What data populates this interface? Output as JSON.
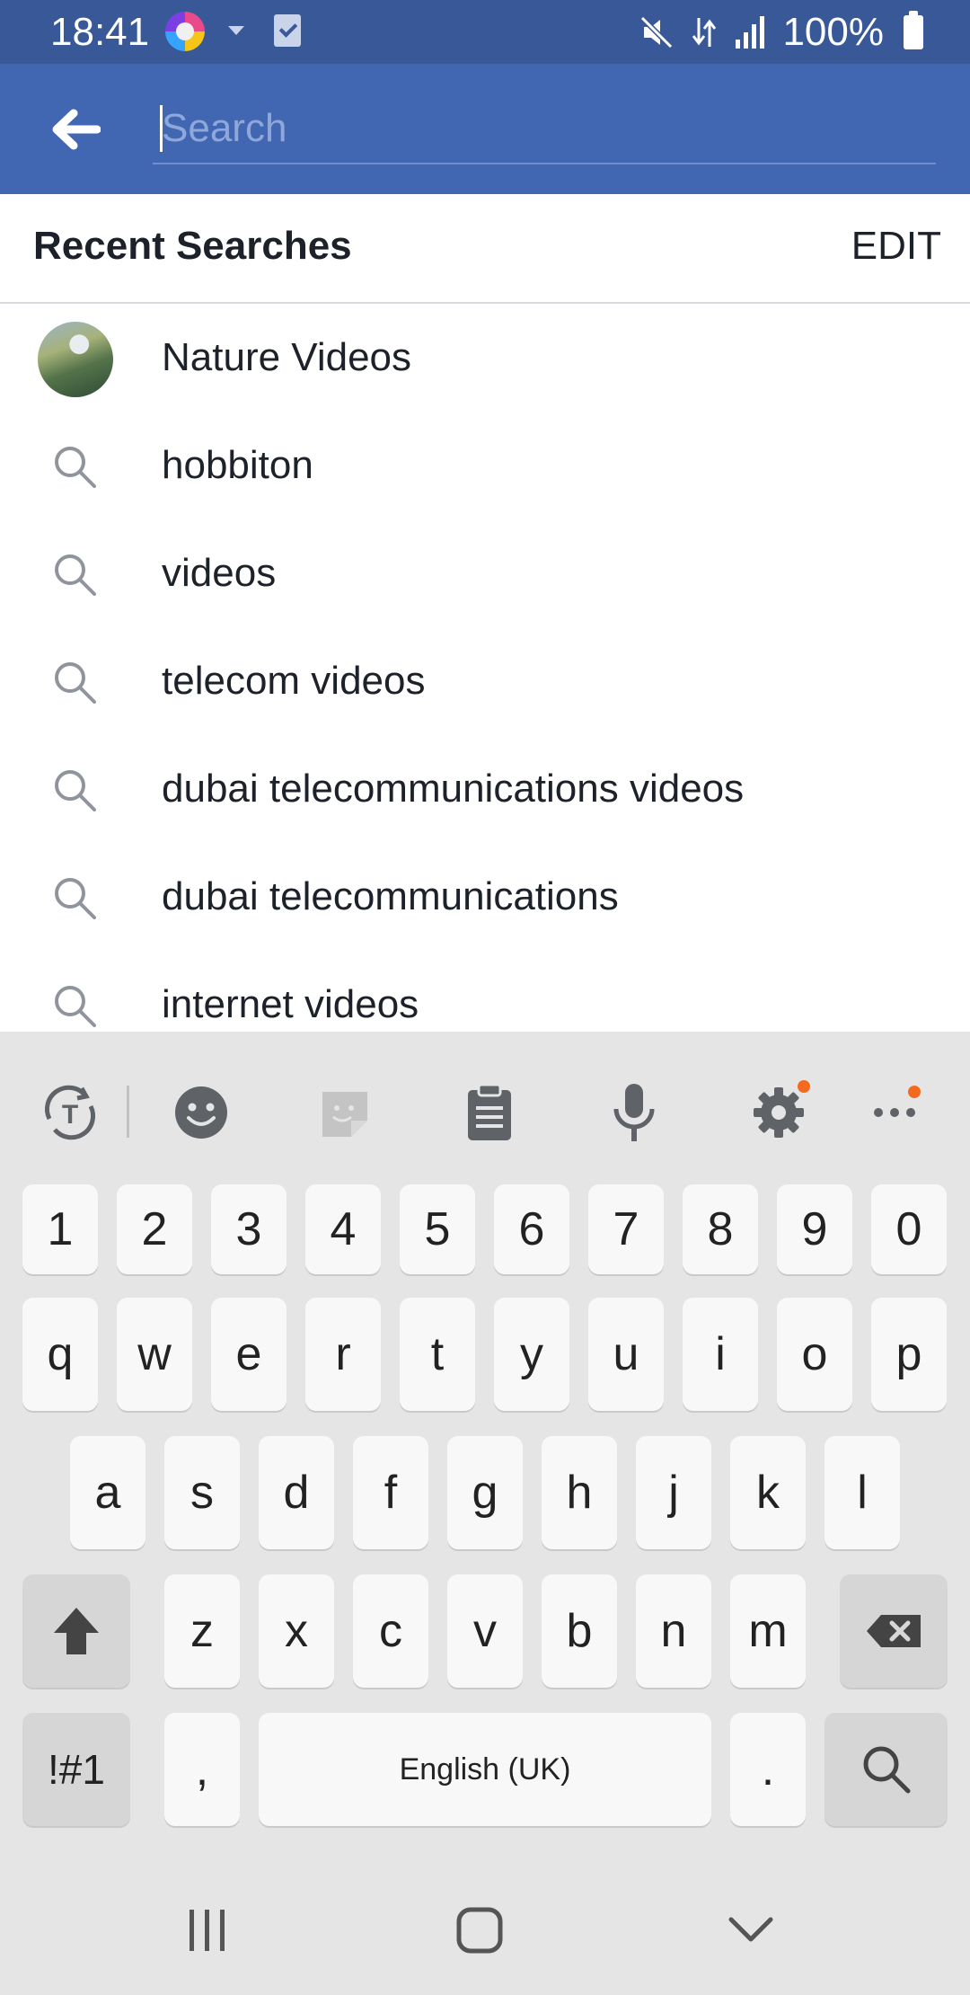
{
  "status_bar": {
    "time": "18:41",
    "battery_percent": "100%",
    "icons": [
      "browser-app-icon",
      "dropdown-caret-icon",
      "checkbox-notification-icon",
      "mute-icon",
      "data-transfer-icon",
      "signal-icon",
      "battery-icon"
    ]
  },
  "search": {
    "placeholder": "Search",
    "value": "",
    "back_icon": "arrow-left-icon"
  },
  "recent": {
    "title": "Recent Searches",
    "edit_label": "EDIT",
    "items": [
      {
        "label": "Nature Videos",
        "icon": "page-thumbnail"
      },
      {
        "label": "hobbiton",
        "icon": "search-icon"
      },
      {
        "label": "videos",
        "icon": "search-icon"
      },
      {
        "label": "telecom videos",
        "icon": "search-icon"
      },
      {
        "label": "dubai telecommunications videos",
        "icon": "search-icon"
      },
      {
        "label": "dubai telecommunications",
        "icon": "search-icon"
      },
      {
        "label": "internet videos",
        "icon": "search-icon"
      }
    ]
  },
  "keyboard": {
    "toolbar": [
      "translate-icon",
      "emoji-icon",
      "sticker-icon",
      "clipboard-icon",
      "microphone-icon",
      "settings-icon",
      "more-icon"
    ],
    "rows": {
      "numbers": [
        "1",
        "2",
        "3",
        "4",
        "5",
        "6",
        "7",
        "8",
        "9",
        "0"
      ],
      "row1": [
        "q",
        "w",
        "e",
        "r",
        "t",
        "y",
        "u",
        "i",
        "o",
        "p"
      ],
      "row2": [
        "a",
        "s",
        "d",
        "f",
        "g",
        "h",
        "j",
        "k",
        "l"
      ],
      "row3": [
        "z",
        "x",
        "c",
        "v",
        "b",
        "n",
        "m"
      ]
    },
    "symbols_label": "!#1",
    "comma_label": ",",
    "space_label": "English (UK)",
    "period_label": ".",
    "accent_color": "#f5691f"
  },
  "nav_bar": {
    "icons": [
      "recent-apps-icon",
      "home-icon",
      "back-chevron-icon"
    ]
  },
  "colors": {
    "status_bar": "#385898",
    "app_bar": "#4267b2",
    "keyboard_bg": "#e5e5e5"
  }
}
